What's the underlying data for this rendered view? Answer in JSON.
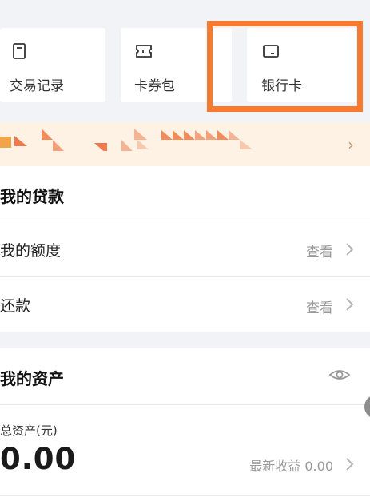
{
  "shortcuts": [
    {
      "label": "交易记录",
      "icon": "receipt-icon"
    },
    {
      "label": "卡券包",
      "icon": "ticket-icon"
    },
    {
      "label": "银行卡",
      "icon": "bank-card-icon"
    }
  ],
  "colors": {
    "highlight": "#f97a2c",
    "banner_bg": "#fdf2e4",
    "muted": "#9a9a9a"
  },
  "loan": {
    "title": "我的贷款",
    "rows": [
      {
        "label": "我的额度",
        "action": "查看"
      },
      {
        "label": "还款",
        "action": "查看"
      }
    ]
  },
  "assets": {
    "title": "我的资产",
    "total_label": "总资产(元)",
    "total_value": "0.00",
    "earnings": "最新收益 0.00"
  }
}
